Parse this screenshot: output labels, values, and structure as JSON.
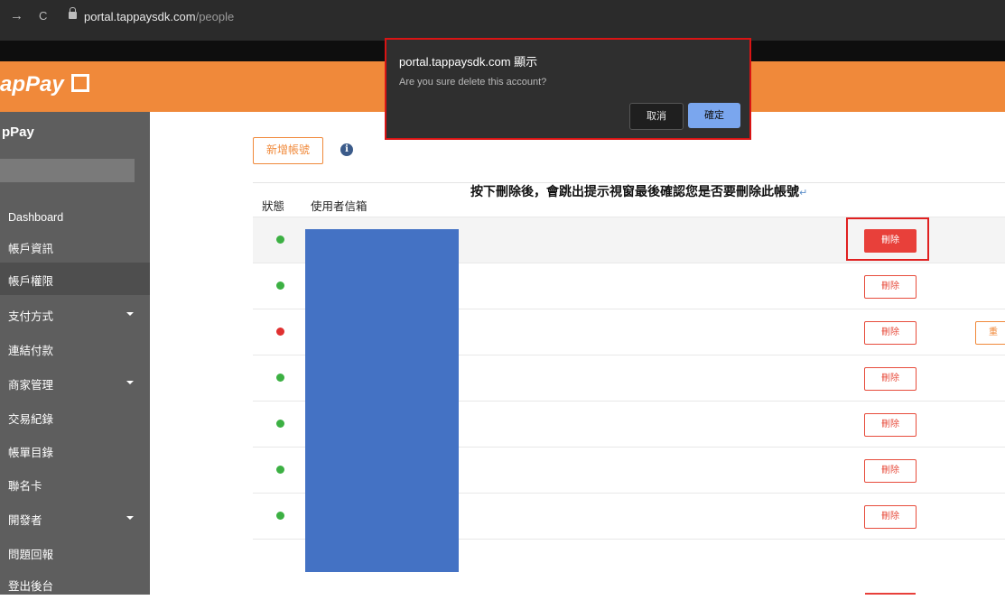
{
  "browser": {
    "back_icon": "←",
    "forward_icon": "→",
    "reload_icon": "C",
    "url_host": "portal.tappaysdk.com",
    "url_path": "/people"
  },
  "header": {
    "logo_text": "apPay"
  },
  "sidebar": {
    "brand": "pPay",
    "items": [
      {
        "label": "Dashboard"
      },
      {
        "label": "帳戶資訊"
      },
      {
        "label": "帳戶權限"
      },
      {
        "label": "支付方式"
      },
      {
        "label": "連結付款"
      },
      {
        "label": "商家管理"
      },
      {
        "label": "交易紀錄"
      },
      {
        "label": "帳單目錄"
      },
      {
        "label": "聯名卡"
      },
      {
        "label": "開發者"
      },
      {
        "label": "問題回報"
      },
      {
        "label": "登出後台"
      }
    ]
  },
  "main": {
    "add_button": "新增帳號",
    "info_glyph": "i",
    "annotation": "按下刪除後，會跳出提示視窗最後確認您是否要刪除此帳號",
    "annotation_mark": "↵",
    "columns": {
      "status": "狀態",
      "email": "使用者信箱"
    },
    "delete_label": "刪除",
    "reset_label": "重",
    "rows": [
      {
        "status": "active"
      },
      {
        "status": "active"
      },
      {
        "status": "inactive"
      },
      {
        "status": "active"
      },
      {
        "status": "active"
      },
      {
        "status": "active"
      },
      {
        "status": "active"
      }
    ]
  },
  "dialog": {
    "title": "portal.tappaysdk.com 顯示",
    "message": "Are you sure delete this account?",
    "cancel": "取消",
    "ok": "確定"
  },
  "colors": {
    "brand_orange": "#f0893a",
    "status_active": "#3cb043",
    "status_inactive": "#e03030",
    "delete_red": "#e8403a",
    "redaction_blue": "#4472c4"
  }
}
